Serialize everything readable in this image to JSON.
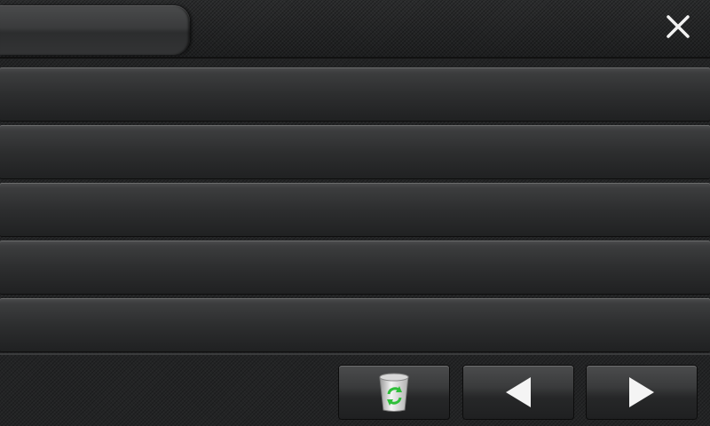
{
  "header": {
    "title": "",
    "close_icon": "close-icon"
  },
  "list": {
    "items": [
      {
        "label": ""
      },
      {
        "label": ""
      },
      {
        "label": ""
      },
      {
        "label": ""
      },
      {
        "label": ""
      }
    ]
  },
  "toolbar": {
    "recycle_icon": "recycle-bin-icon",
    "prev_icon": "arrow-left-icon",
    "next_icon": "arrow-right-icon",
    "recycle_accent": "#2fbf3a"
  }
}
